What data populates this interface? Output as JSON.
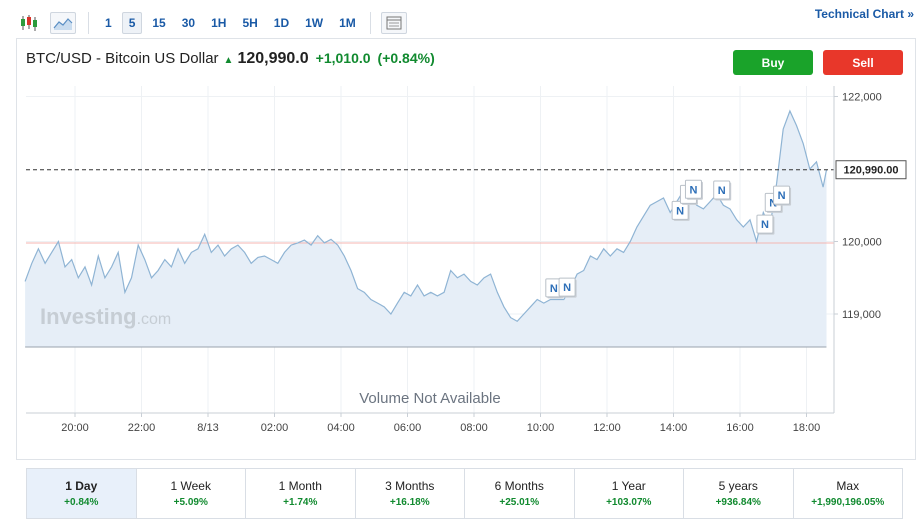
{
  "toolbar": {
    "icons": [
      "candlestick-icon",
      "area-chart-icon",
      "layout-icon"
    ],
    "intervals": [
      "1",
      "5",
      "15",
      "30",
      "1H",
      "5H",
      "1D",
      "1W",
      "1M"
    ],
    "active_interval": "5",
    "technical_chart_label": "Technical Chart",
    "technical_chart_arrow": "»"
  },
  "header": {
    "name": "BTC/USD - Bitcoin US Dollar",
    "price": "120,990.0",
    "change": "+1,010.0",
    "change_pct": "(+0.84%)"
  },
  "actions": {
    "buy_label": "Buy",
    "sell_label": "Sell"
  },
  "colors": {
    "line": "#8fb4d4",
    "area": "#e6eef7",
    "positive": "#118a2f",
    "buy": "#1aa32a",
    "sell": "#e8372a",
    "prev_close_line": "#f4b6b0",
    "link": "#1a5aa6"
  },
  "chart_data": {
    "type": "area",
    "x_ticks": [
      "20:00",
      "22:00",
      "8/13",
      "02:00",
      "04:00",
      "06:00",
      "08:00",
      "10:00",
      "12:00",
      "14:00",
      "16:00",
      "18:00"
    ],
    "y_ticks": [
      "122,000",
      "120,000",
      "119,000"
    ],
    "y_tick_values": [
      122000,
      120000,
      119000
    ],
    "current_price_label": "120,990.00",
    "current_price": 120990,
    "prev_close": 119980,
    "ylim": [
      118500,
      122200
    ],
    "watermark": "Investing",
    "watermark_suffix": ".com",
    "volume_text": "Volume Not Available",
    "news_marker_label": "N",
    "news_markers": [
      {
        "hours": 14.4,
        "value": 119360
      },
      {
        "hours": 14.8,
        "value": 119370
      },
      {
        "hours": 18.2,
        "value": 120430
      },
      {
        "hours": 18.45,
        "value": 120650
      },
      {
        "hours": 18.6,
        "value": 120720
      },
      {
        "hours": 19.45,
        "value": 120710
      },
      {
        "hours": 20.75,
        "value": 120240
      },
      {
        "hours": 21.0,
        "value": 120540
      },
      {
        "hours": 21.25,
        "value": 120640
      }
    ],
    "series": {
      "hours_since_first_tick": [
        -1.5,
        -1.3,
        -1.1,
        -0.9,
        -0.7,
        -0.5,
        -0.3,
        -0.1,
        0.1,
        0.3,
        0.5,
        0.7,
        0.9,
        1.1,
        1.3,
        1.5,
        1.7,
        1.9,
        2.1,
        2.3,
        2.5,
        2.7,
        2.9,
        3.1,
        3.3,
        3.5,
        3.7,
        3.9,
        4.1,
        4.3,
        4.5,
        4.7,
        4.9,
        5.1,
        5.3,
        5.5,
        5.7,
        5.9,
        6.1,
        6.3,
        6.5,
        6.7,
        6.9,
        7.1,
        7.3,
        7.5,
        7.7,
        7.9,
        8.1,
        8.3,
        8.5,
        8.7,
        8.9,
        9.1,
        9.3,
        9.5,
        9.7,
        9.9,
        10.1,
        10.3,
        10.5,
        10.7,
        10.9,
        11.1,
        11.3,
        11.5,
        11.7,
        11.9,
        12.1,
        12.3,
        12.5,
        12.7,
        12.9,
        13.1,
        13.3,
        13.5,
        13.7,
        13.9,
        14.1,
        14.3,
        14.5,
        14.7,
        14.9,
        15.1,
        15.3,
        15.5,
        15.7,
        15.9,
        16.1,
        16.3,
        16.5,
        16.7,
        16.9,
        17.1,
        17.3,
        17.5,
        17.7,
        17.9,
        18.1,
        18.3,
        18.5,
        18.7,
        18.9,
        19.1,
        19.3,
        19.5,
        19.7,
        19.9,
        20.1,
        20.3,
        20.5,
        20.7,
        20.9,
        21.1,
        21.3,
        21.5,
        21.7,
        21.9,
        22.1,
        22.3,
        22.5,
        22.6
      ],
      "values": [
        119450,
        119700,
        119900,
        119700,
        119850,
        120000,
        119650,
        119750,
        119500,
        119650,
        119400,
        119800,
        119500,
        119650,
        119850,
        119300,
        119500,
        119950,
        119750,
        119500,
        119600,
        119750,
        119650,
        119900,
        119700,
        119850,
        119900,
        120100,
        119850,
        119950,
        119800,
        119900,
        119950,
        119850,
        119700,
        119780,
        119800,
        119750,
        119700,
        119850,
        119950,
        119980,
        120020,
        119950,
        120080,
        119980,
        120030,
        119950,
        119800,
        119600,
        119350,
        119300,
        119200,
        119150,
        119100,
        119000,
        119150,
        119300,
        119250,
        119400,
        119250,
        119300,
        119250,
        119300,
        119600,
        119500,
        119550,
        119450,
        119400,
        119500,
        119550,
        119300,
        119100,
        118950,
        118900,
        119000,
        119100,
        119200,
        119150,
        119200,
        119200,
        119200,
        119350,
        119550,
        119600,
        119800,
        119750,
        119900,
        119800,
        119900,
        119850,
        120000,
        120200,
        120350,
        120500,
        120550,
        120600,
        120400,
        120550,
        120700,
        120600,
        120500,
        120450,
        120550,
        120650,
        120500,
        120450,
        120300,
        120200,
        120300,
        120000,
        120400,
        120200,
        120800,
        121550,
        121800,
        121600,
        121350,
        121000,
        121100,
        120750,
        120990
      ]
    }
  },
  "periods": [
    {
      "label": "1 Day",
      "change": "+0.84%"
    },
    {
      "label": "1 Week",
      "change": "+5.09%"
    },
    {
      "label": "1 Month",
      "change": "+1.74%"
    },
    {
      "label": "3 Months",
      "change": "+16.18%"
    },
    {
      "label": "6 Months",
      "change": "+25.01%"
    },
    {
      "label": "1 Year",
      "change": "+103.07%"
    },
    {
      "label": "5 years",
      "change": "+936.84%"
    },
    {
      "label": "Max",
      "change": "+1,990,196.05%"
    }
  ],
  "active_period": "1 Day"
}
